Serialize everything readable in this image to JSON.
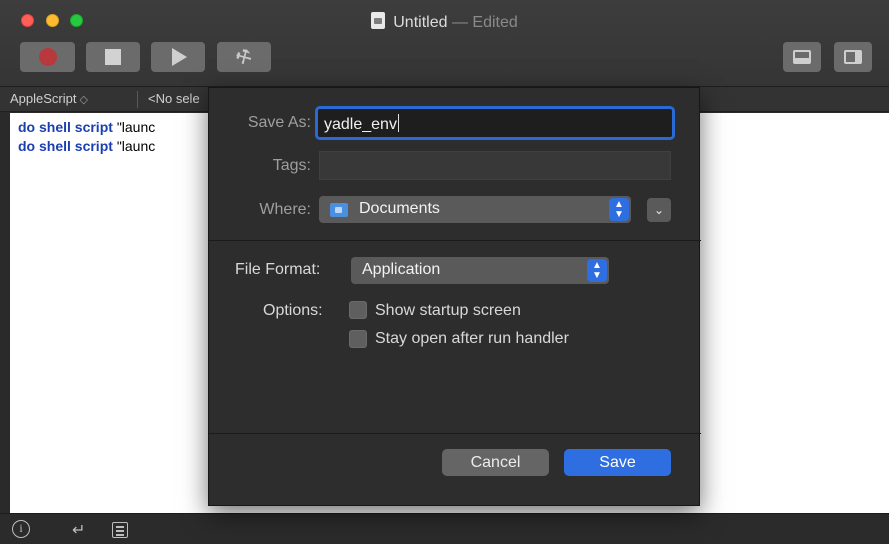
{
  "window": {
    "title": "Untitled",
    "title_separator": "—",
    "title_status": "Edited"
  },
  "toolbar": {
    "buttons": [
      {
        "name": "record",
        "icon": "record-icon"
      },
      {
        "name": "stop",
        "icon": "stop-icon"
      },
      {
        "name": "run",
        "icon": "play-icon"
      },
      {
        "name": "compile",
        "icon": "hammer-icon"
      }
    ],
    "view_buttons": [
      "bottom-pane-icon",
      "side-pane-icon"
    ]
  },
  "navbar": {
    "language": "AppleScript",
    "language_chevron": "◇",
    "selection": "<No sele"
  },
  "editor": {
    "lines": [
      {
        "keyword": "do shell script",
        "text": "\"launc"
      },
      {
        "keyword": "do shell script",
        "text": "\"launc"
      }
    ]
  },
  "save_sheet": {
    "save_as_label": "Save As:",
    "save_as_value": "yadle_env",
    "tags_label": "Tags:",
    "tags_value": "",
    "where_label": "Where:",
    "where_value": "Documents",
    "file_format_label": "File Format:",
    "file_format_value": "Application",
    "options_label": "Options:",
    "options": [
      {
        "label": "Show startup screen",
        "checked": false
      },
      {
        "label": "Stay open after run handler",
        "checked": false
      }
    ],
    "cancel_label": "Cancel",
    "save_label": "Save"
  },
  "colors": {
    "accent": "#2f6ee0",
    "keyword": "#1c3fb0",
    "record": "#b7393d"
  }
}
